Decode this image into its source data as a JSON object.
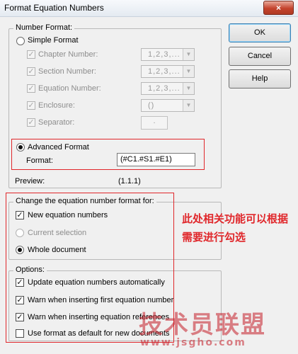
{
  "window": {
    "title": "Format Equation Numbers",
    "close_glyph": "×"
  },
  "buttons": {
    "ok": "OK",
    "cancel": "Cancel",
    "help": "Help"
  },
  "number_format": {
    "legend": "Number Format:",
    "simple_label": "Simple Format",
    "simple_selected": false,
    "items": [
      {
        "label": "Chapter Number:",
        "value": "1,2,3,..."
      },
      {
        "label": "Section Number:",
        "value": "1,2,3,..."
      },
      {
        "label": "Equation Number:",
        "value": "1,2,3,..."
      },
      {
        "label": "Enclosure:",
        "value": "()"
      },
      {
        "label": "Separator:",
        "value": "."
      }
    ],
    "advanced_label": "Advanced Format",
    "advanced_selected": true,
    "format_label": "Format:",
    "format_value": "(#C1.#S1.#E1)",
    "preview_label": "Preview:",
    "preview_value": "(1.1.1)"
  },
  "change_for": {
    "legend": "Change the equation number format for:",
    "new_equations": "New equation numbers",
    "current_selection": "Current selection",
    "whole_document": "Whole document",
    "whole_document_selected": true
  },
  "options": {
    "legend": "Options:",
    "items": [
      {
        "label": "Update equation numbers automatically",
        "checked": true
      },
      {
        "label": "Warn when inserting first equation number",
        "checked": true
      },
      {
        "label": "Warn when inserting equation references",
        "checked": true
      },
      {
        "label": "Use format as default for new documents",
        "checked": false
      }
    ]
  },
  "annotation": {
    "line1": "此处相关功能可以根据",
    "line2": "需要进行勾选"
  },
  "watermark": {
    "brand": "技术员联盟",
    "url": "www.jsgho.com"
  },
  "colors": {
    "annotation_red": "#e0272b"
  }
}
